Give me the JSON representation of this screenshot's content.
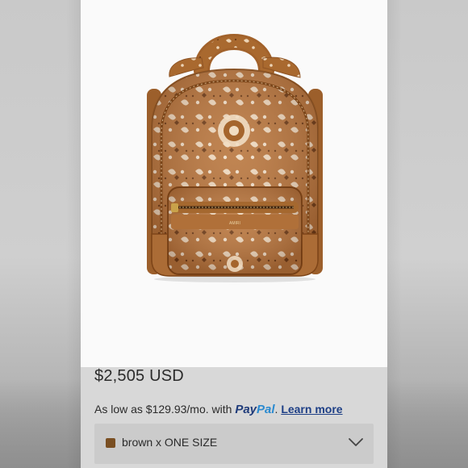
{
  "listing": {
    "price": "$2,505 USD",
    "installment": {
      "prefix": "As low as $129.93/mo. with ",
      "paypal_pay": "Pay",
      "paypal_pal": "Pal",
      "separator": ". ",
      "learn_more": "Learn more"
    },
    "variant": {
      "label": "brown x ONE SIZE",
      "swatch_color": "#7a4f22",
      "icon": "chevron-down-icon"
    }
  },
  "product": {
    "image": "backpack-product-image",
    "primary_color": "#b9773f",
    "leather_color": "#a86b35"
  },
  "colors": {
    "paypal_dark": "#1f3b7a",
    "paypal_light": "#2a8ad0",
    "link": "#1e3f86"
  }
}
